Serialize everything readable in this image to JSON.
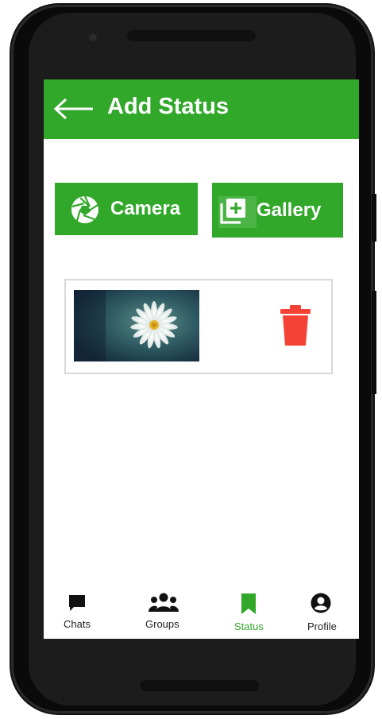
{
  "app_bar": {
    "title": "Add Status",
    "back_icon": "arrow-left-icon",
    "color": "#32a82b"
  },
  "actions": {
    "camera_label": "Camera",
    "camera_icon": "camera-shutter-icon",
    "gallery_label": "Gallery",
    "gallery_icon": "add-to-photos-icon"
  },
  "status_item": {
    "thumbnail": "daisy-flower-image",
    "delete_icon": "trash-icon",
    "delete_color": "#f44336"
  },
  "bottom_nav": {
    "items": [
      {
        "label": "Chats",
        "icon": "chat-bubble-icon"
      },
      {
        "label": "Groups",
        "icon": "groups-icon"
      },
      {
        "label": "Status",
        "icon": "bookmark-icon",
        "active": true
      },
      {
        "label": "Profile",
        "icon": "account-circle-icon"
      }
    ],
    "active_color": "#32a82b"
  }
}
